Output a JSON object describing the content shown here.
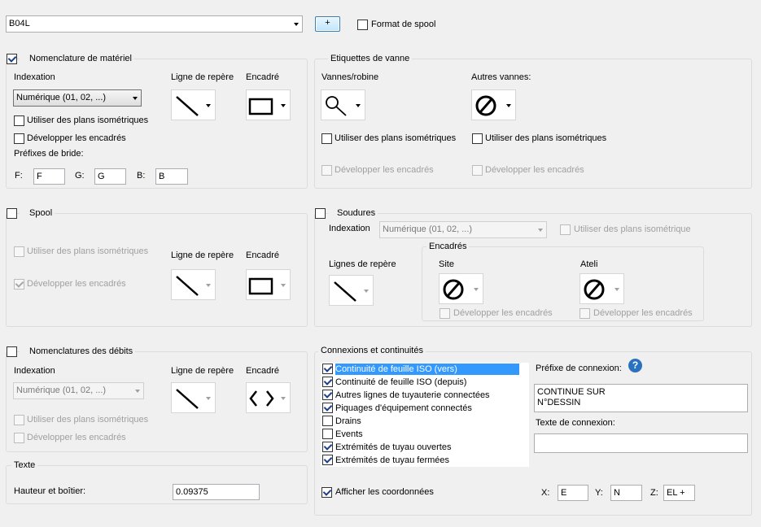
{
  "top": {
    "style_combo": "B04L",
    "plus_label": "+",
    "spool_format_label": "Format de spool"
  },
  "bom": {
    "title": "Nomenclature de matériel",
    "indexation_label": "Indexation",
    "indexation_value": "Numérique (01, 02, ...)",
    "leader_label": "Ligne de repère",
    "frame_label": "Encadré",
    "iso_label": "Utiliser des plans isométriques",
    "expand_label": "Développer les encadrés",
    "flange_label": "Préfixes de bride:",
    "f_label": "F:",
    "f_value": "F",
    "g_label": "G:",
    "g_value": "G",
    "b_label": "B:",
    "b_value": "B"
  },
  "valve": {
    "title": "Etiquettes de vanne",
    "valves_label": "Vannes/robine",
    "other_label": "Autres vannes:",
    "iso1_label": "Utiliser des plans isométriques",
    "iso2_label": "Utiliser des plans isométriques",
    "expand1_label": "Développer les encadrés",
    "expand2_label": "Développer les encadrés"
  },
  "spool": {
    "title": "Spool",
    "iso_label": "Utiliser des plans isométriques",
    "expand_label": "Développer les encadrés",
    "leader_label": "Ligne de repère",
    "frame_label": "Encadré"
  },
  "welds": {
    "title": "Soudures",
    "indexation_label": "Indexation",
    "indexation_value": "Numérique (01, 02, ...)",
    "iso_label": "Utiliser des plans isométrique",
    "leaders_label": "Lignes de repère",
    "frames_title": "Encadrés",
    "site_label": "Site",
    "shop_label": "Ateli",
    "expand1_label": "Développer les encadrés",
    "expand2_label": "Développer les encadrés"
  },
  "cut": {
    "title": "Nomenclatures des débits",
    "indexation_label": "Indexation",
    "indexation_value": "Numérique (01, 02, ...)",
    "leader_label": "Ligne de repère",
    "frame_label": "Encadré",
    "iso_label": "Utiliser des plans isométriques",
    "expand_label": "Développer les encadrés"
  },
  "text": {
    "title": "Texte",
    "height_label": "Hauteur et boîtier:",
    "height_value": "0.09375"
  },
  "conn": {
    "title": "Connexions et continuités",
    "items": [
      {
        "label": "Continuité de feuille ISO (vers)",
        "checked": true
      },
      {
        "label": "Continuité de feuille ISO (depuis)",
        "checked": true
      },
      {
        "label": "Autres lignes de tuyauterie connectées",
        "checked": true
      },
      {
        "label": "Piquages d'équipement connectés",
        "checked": true
      },
      {
        "label": "Drains",
        "checked": false
      },
      {
        "label": "Events",
        "checked": false
      },
      {
        "label": "Extrémités de tuyau ouvertes",
        "checked": true
      },
      {
        "label": "Extrémités de tuyau fermées",
        "checked": true
      }
    ],
    "prefix_label": "Préfixe de connexion:",
    "help_glyph": "?",
    "prefix_line1": "CONTINUE SUR",
    "prefix_line2": "N°DESSIN",
    "text_label": "Texte de connexion:",
    "text_value": "",
    "coords_label": "Afficher les coordonnées",
    "x_label": "X:",
    "x_value": "E",
    "y_label": "Y:",
    "y_value": "N",
    "z_label": "Z:",
    "z_value": "EL +"
  }
}
